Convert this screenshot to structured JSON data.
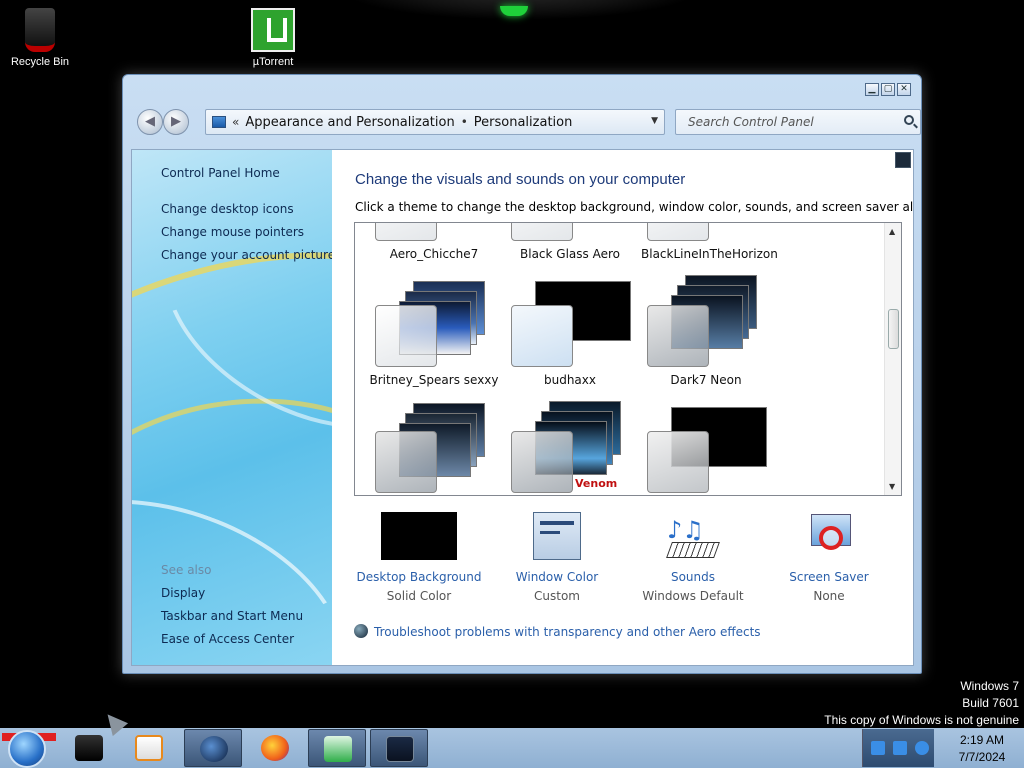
{
  "desktop": {
    "icons": [
      {
        "label": "Recycle Bin"
      },
      {
        "label": "µTorrent"
      }
    ],
    "watermark": {
      "line1": "Windows 7",
      "line2": "Build 7601",
      "line3": "This copy of Windows is not genuine"
    }
  },
  "window": {
    "controls": {
      "minimize": "▁",
      "maximize": "▢",
      "close": "✕"
    },
    "address": {
      "chevron": "«",
      "crumb1": "Appearance and Personalization",
      "separator": "•",
      "crumb2": "Personalization",
      "dropdown": "▼"
    },
    "refresh": "↻",
    "search_placeholder": "Search Control Panel"
  },
  "sidebar": {
    "home": "Control Panel Home",
    "links": [
      "Change desktop icons",
      "Change mouse pointers",
      "Change your account picture"
    ],
    "see_also_label": "See also",
    "see_also": [
      "Display",
      "Taskbar and Start Menu",
      "Ease of Access Center"
    ]
  },
  "main": {
    "title": "Change the visuals and sounds on your computer",
    "subtitle": "Click a theme to change the desktop background, window color, sounds, and screen saver all at once.",
    "themes": [
      {
        "name": "Aero_Chicche7"
      },
      {
        "name": "Black Glass Aero"
      },
      {
        "name": "BlackLineInTheHorizon"
      },
      {
        "name": "Britney_Spears sexxy"
      },
      {
        "name": "budhaxx"
      },
      {
        "name": "Dark7 Neon"
      },
      {
        "name": ""
      },
      {
        "name": "",
        "overlay": "Venom"
      },
      {
        "name": ""
      }
    ],
    "options": [
      {
        "label": "Desktop Background",
        "value": "Solid Color"
      },
      {
        "label": "Window Color",
        "value": "Custom"
      },
      {
        "label": "Sounds",
        "value": "Windows Default"
      },
      {
        "label": "Screen Saver",
        "value": "None"
      }
    ],
    "troubleshoot": "Troubleshoot problems with transparency and other Aero effects"
  },
  "taskbar": {
    "clock_time": "2:19 AM",
    "clock_date": "7/7/2024"
  },
  "colors": {
    "link_blue": "#2a5faa",
    "title_blue": "#1e3b7a",
    "sidebar_gradient": "#5cc0ea"
  }
}
